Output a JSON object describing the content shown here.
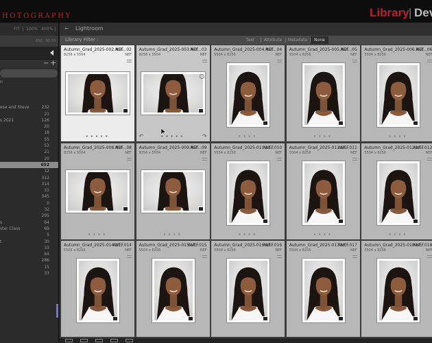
{
  "header": {
    "brand": "HOTOGRAPHY",
    "module_active": "Library",
    "module_separator": "|",
    "module_next": "Dev"
  },
  "navigator": {
    "zoom_levels": [
      "FIT ❘",
      "100%",
      "400%",
      "❘"
    ],
    "readout": "850 - 90 10"
  },
  "collections": {
    "items": [
      {
        "name": "n",
        "count": ""
      },
      {
        "name": "",
        "count": ""
      },
      {
        "name": "",
        "count": ""
      },
      {
        "name": "",
        "count": ""
      },
      {
        "name": "ese and Steve",
        "count": "232"
      },
      {
        "name": "",
        "count": "21"
      },
      {
        "name": "s 2021",
        "count": "126"
      },
      {
        "name": "",
        "count": "20"
      },
      {
        "name": "",
        "count": "18"
      },
      {
        "name": "",
        "count": "55"
      },
      {
        "name": "",
        "count": "53"
      },
      {
        "name": "",
        "count": "21"
      },
      {
        "name": "",
        "count": "20"
      },
      {
        "name": "",
        "count": "652"
      },
      {
        "name": "",
        "count": "12"
      },
      {
        "name": "",
        "count": "312"
      },
      {
        "name": "",
        "count": "314"
      },
      {
        "name": "",
        "count": "31"
      },
      {
        "name": "",
        "count": "345"
      },
      {
        "name": "",
        "count": "0"
      },
      {
        "name": "",
        "count": "32"
      },
      {
        "name": "",
        "count": "205"
      },
      {
        "name": "s",
        "count": "64"
      },
      {
        "name": "ster Class",
        "count": "69"
      },
      {
        "name": "",
        "count": "5"
      },
      {
        "name": "t",
        "count": "30"
      },
      {
        "name": "",
        "count": "33"
      },
      {
        "name": "",
        "count": "64"
      },
      {
        "name": "",
        "count": "286"
      },
      {
        "name": "",
        "count": "15"
      },
      {
        "name": "",
        "count": "33"
      }
    ]
  },
  "breadcrumb": {
    "text": "Lightroom"
  },
  "filter_bar": {
    "label": "Library Filter :",
    "tabs": [
      "Text",
      "Attribute",
      "Metadata",
      "None"
    ],
    "active_tab": "None"
  },
  "grid": {
    "cells": [
      {
        "name": "Autumn_Grad_2025-002.NEF",
        "idx": "Aut...02",
        "dim": "8256 x 5504",
        "ext": "NEF",
        "orient": "landscape",
        "state": "sel"
      },
      {
        "name": "Autumn_Grad_2025-003.NEF",
        "idx": "Aut...03",
        "dim": "8256 x 5504",
        "ext": "NEF",
        "orient": "landscape",
        "state": "hi"
      },
      {
        "name": "Autumn_Grad_2025-004.NEF",
        "idx": "Aut...04",
        "dim": "5504 x 8256",
        "ext": "NEF",
        "orient": "portrait",
        "state": ""
      },
      {
        "name": "Autumn_Grad_2025-005.NEF",
        "idx": "Aut...05",
        "dim": "5504 x 8256",
        "ext": "NEF",
        "orient": "portrait",
        "state": ""
      },
      {
        "name": "Autumn_Grad_2025-006.NEF",
        "idx": "Aut...06",
        "dim": "5504 x 8256",
        "ext": "NEF",
        "orient": "portrait",
        "state": ""
      },
      {
        "name": "Autumn_Grad_2025-008.NEF",
        "idx": "Aut...08",
        "dim": "8256 x 5504",
        "ext": "NEF",
        "orient": "landscape",
        "state": ""
      },
      {
        "name": "Autumn_Grad_2025-009.NEF",
        "idx": "Aut...09",
        "dim": "8256 x 5504",
        "ext": "NEF",
        "orient": "landscape",
        "state": ""
      },
      {
        "name": "Autumn_Grad_2025-010.NEF",
        "idx": "Aut...010",
        "dim": "5504 x 8256",
        "ext": "NEF",
        "orient": "portrait",
        "state": ""
      },
      {
        "name": "Autumn_Grad_2025-011.NEF",
        "idx": "Aut...011",
        "dim": "5504 x 8256",
        "ext": "NEF",
        "orient": "portrait",
        "state": ""
      },
      {
        "name": "Autumn_Grad_2025-012.NEF",
        "idx": "Aut...012",
        "dim": "5504 x 8256",
        "ext": "NEF",
        "orient": "portrait",
        "state": ""
      },
      {
        "name": "Autumn_Grad_2025-014.NEF",
        "idx": "Aut...014",
        "dim": "5504 x 8256",
        "ext": "NEF",
        "orient": "portrait",
        "state": ""
      },
      {
        "name": "Autumn_Grad_2025-015.NEF",
        "idx": "Aut...015",
        "dim": "5504 x 8256",
        "ext": "NEF",
        "orient": "portrait",
        "state": ""
      },
      {
        "name": "Autumn_Grad_2025-016.NEF",
        "idx": "Aut...016",
        "dim": "5504 x 8256",
        "ext": "NEF",
        "orient": "portrait",
        "state": ""
      },
      {
        "name": "Autumn_Grad_2025-017.NEF",
        "idx": "Aut...017",
        "dim": "5504 x 8256",
        "ext": "NEF",
        "orient": "portrait",
        "state": ""
      },
      {
        "name": "Autumn_Grad_2025-018.NEF",
        "idx": "Aut...018",
        "dim": "5504 x 8256",
        "ext": "NEF",
        "orient": "portrait",
        "state": ""
      }
    ],
    "selected_collection_index": 13
  },
  "colors": {
    "brand_red": "#c8202a",
    "panel_bg": "#2b2b2b",
    "grid_bg": "#3d3d3d",
    "cell_bg": "#b7b7b7",
    "cell_selected": "#ececec"
  }
}
